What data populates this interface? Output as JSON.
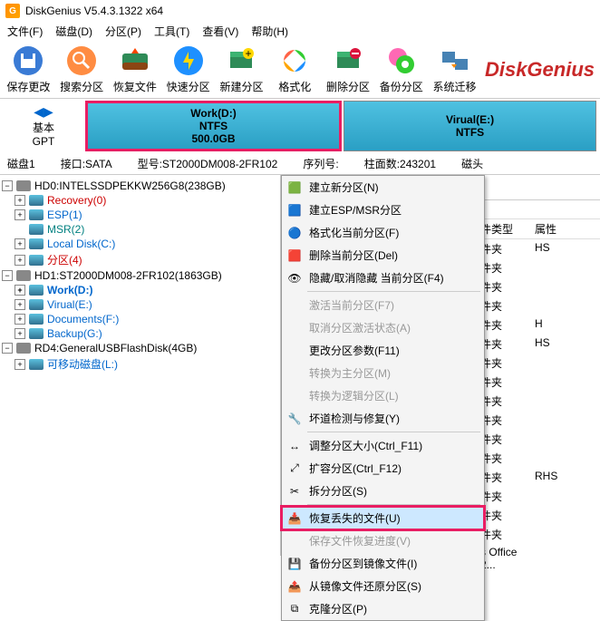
{
  "window": {
    "title": "DiskGenius V5.4.3.1322 x64"
  },
  "menu": {
    "file": "文件(F)",
    "disk": "磁盘(D)",
    "partition": "分区(P)",
    "tools": "工具(T)",
    "view": "查看(V)",
    "help": "帮助(H)"
  },
  "toolbar": {
    "save": "保存更改",
    "search": "搜索分区",
    "recover": "恢复文件",
    "quick": "快速分区",
    "new": "新建分区",
    "format": "格式化",
    "delete": "删除分区",
    "backup": "备份分区",
    "migrate": "系统迁移"
  },
  "brand": "DiskGenius",
  "nav": {
    "basic": "基本",
    "gpt": "GPT"
  },
  "partitions": {
    "work": {
      "name": "Work(D:)",
      "fs": "NTFS",
      "size": "500.0GB"
    },
    "virtual": {
      "name": "Virual(E:)",
      "fs": "NTFS"
    }
  },
  "status": {
    "disk": "磁盘1",
    "iface": "接口:SATA",
    "model": "型号:ST2000DM008-2FR102",
    "serial": "序列号:",
    "cylinders": "柱面数:243201",
    "heads": "磁头"
  },
  "tree": {
    "hd0": "HD0:INTELSSDPEKKW256G8(238GB)",
    "recovery": "Recovery(0)",
    "esp": "ESP(1)",
    "msr": "MSR(2)",
    "localc": "Local Disk(C:)",
    "part4": "分区(4)",
    "hd1": "HD1:ST2000DM008-2FR102(1863GB)",
    "workd": "Work(D:)",
    "viruale": "Virual(E:)",
    "documentsf": "Documents(F:)",
    "backupg": "Backup(G:)",
    "rd4": "RD4:GeneralUSBFlashDisk(4GB)",
    "removable": "可移动磁盘(L:)"
  },
  "tabsrow": {
    "tab1": "分"
  },
  "filehdr": {
    "c1": "件类型",
    "c2": "属性"
  },
  "ctx": {
    "new_part": "建立新分区(N)",
    "esp_msr": "建立ESP/MSR分区",
    "format_cur": "格式化当前分区(F)",
    "del_cur": "删除当前分区(Del)",
    "hide": "隐藏/取消隐藏 当前分区(F4)",
    "activate": "激活当前分区(F7)",
    "deactivate": "取消分区激活状态(A)",
    "params": "更改分区参数(F11)",
    "primary": "转换为主分区(M)",
    "logical": "转换为逻辑分区(L)",
    "badsector": "坏道检测与修复(Y)",
    "resize": "调整分区大小(Ctrl_F11)",
    "extend": "扩容分区(Ctrl_F12)",
    "split": "拆分分区(S)",
    "recover_files": "恢复丢失的文件(U)",
    "save_progress": "保存文件恢复进度(V)",
    "backup_img": "备份分区到镜像文件(I)",
    "restore_img": "从镜像文件还原分区(S)",
    "clone": "克隆分区(P)"
  },
  "files": {
    "row_type": "件夹",
    "attrs": {
      "hs": "HS",
      "h": "H",
      "rhs": "RHS"
    },
    "office": "s Office 2..."
  }
}
